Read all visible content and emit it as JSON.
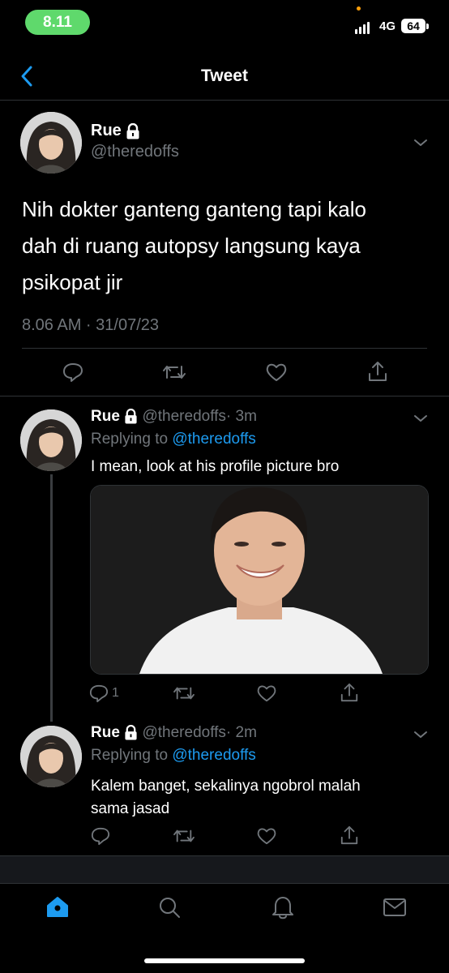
{
  "status_bar": {
    "time": "8.11",
    "network": "4G",
    "battery": "64"
  },
  "nav": {
    "title": "Tweet"
  },
  "main_tweet": {
    "name": "Rue",
    "handle": "@theredoffs",
    "text_lines": [
      "Nih dokter ganteng ganteng tapi kalo",
      "dah di ruang autopsy langsung kaya",
      "psikopat jir"
    ],
    "timestamp": "8.06 AM · 31/07/23"
  },
  "replies": [
    {
      "name": "Rue",
      "handle": "@theredoffs",
      "time": "· 3m",
      "replying_label": "Replying to",
      "replying_handle": "@theredoffs",
      "text_lines": [
        "I mean, look at his profile picture bro"
      ],
      "reply_count": "1"
    },
    {
      "name": "Rue",
      "handle": "@theredoffs",
      "time": "· 2m",
      "replying_label": "Replying to",
      "replying_handle": "@theredoffs",
      "text_lines": [
        "Kalem banget, sekalinya ngobrol malah",
        "sama jasad"
      ],
      "reply_count": ""
    }
  ],
  "icons": [
    "back-chevron-icon",
    "lock-icon",
    "chevron-down-icon",
    "reply-icon",
    "retweet-icon",
    "like-icon",
    "share-icon",
    "home-icon",
    "search-icon",
    "notifications-icon",
    "messages-icon"
  ],
  "colors": {
    "background": "#000000",
    "accent": "#1d9bf0",
    "secondary_text": "#71767b",
    "divider": "#2f3336",
    "time_pill": "#5fd96c"
  }
}
